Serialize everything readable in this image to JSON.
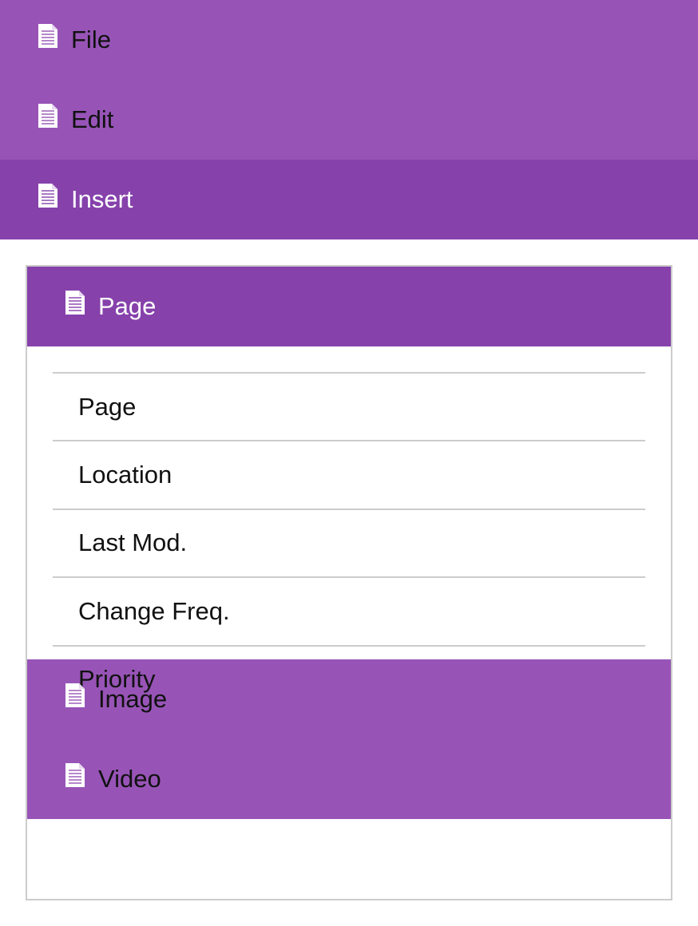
{
  "menu": {
    "items": [
      {
        "label": "File",
        "icon": "document-icon"
      },
      {
        "label": "Edit",
        "icon": "document-icon"
      },
      {
        "label": "Insert",
        "icon": "document-icon",
        "active": true
      }
    ]
  },
  "submenu": {
    "header": {
      "label": "Page",
      "icon": "document-icon"
    },
    "options": [
      "Page",
      "Location",
      "Last Mod.",
      "Change Freq.",
      "Priority"
    ],
    "footer_items": [
      {
        "label": "Image",
        "icon": "document-icon"
      },
      {
        "label": "Video",
        "icon": "document-icon"
      }
    ]
  },
  "colors": {
    "menu_bg": "#9754b6",
    "active_bg": "#8641ab",
    "border": "#cccccc"
  }
}
